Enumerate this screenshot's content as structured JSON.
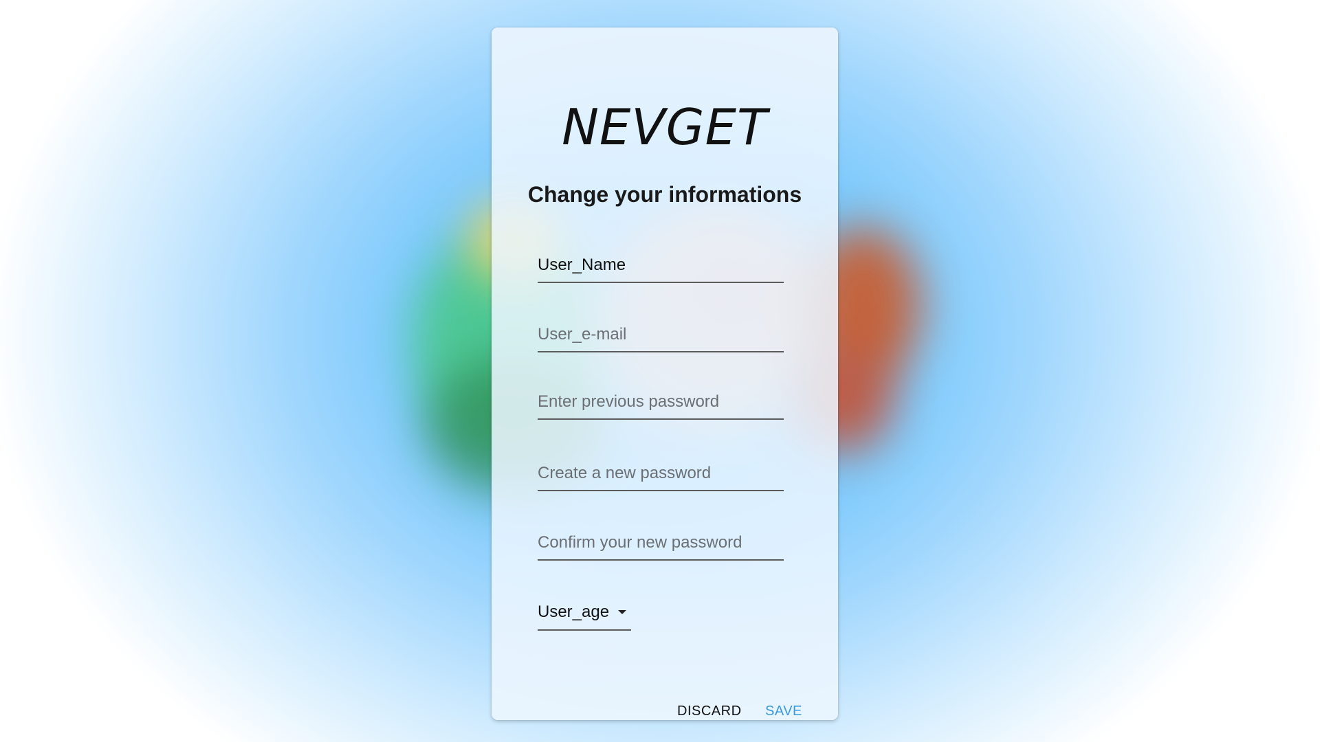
{
  "brand": {
    "logo_text": "NEVGET"
  },
  "form": {
    "title": "Change your informations",
    "fields": {
      "username": {
        "value": "User_Name",
        "placeholder": ""
      },
      "email": {
        "value": "",
        "placeholder": "User_e-mail"
      },
      "previous_password": {
        "value": "",
        "placeholder": "Enter previous password"
      },
      "new_password": {
        "value": "",
        "placeholder": "Create a new password"
      },
      "confirm_password": {
        "value": "",
        "placeholder": "Confirm your new password"
      }
    },
    "age_select": {
      "selected": "User_age",
      "icon": "caret-down-icon"
    }
  },
  "actions": {
    "discard_label": "DISCARD",
    "save_label": "SAVE"
  },
  "colors": {
    "accent": "#3a9ad9",
    "background": "#6ac3fc",
    "card": "#ecf6ff"
  }
}
